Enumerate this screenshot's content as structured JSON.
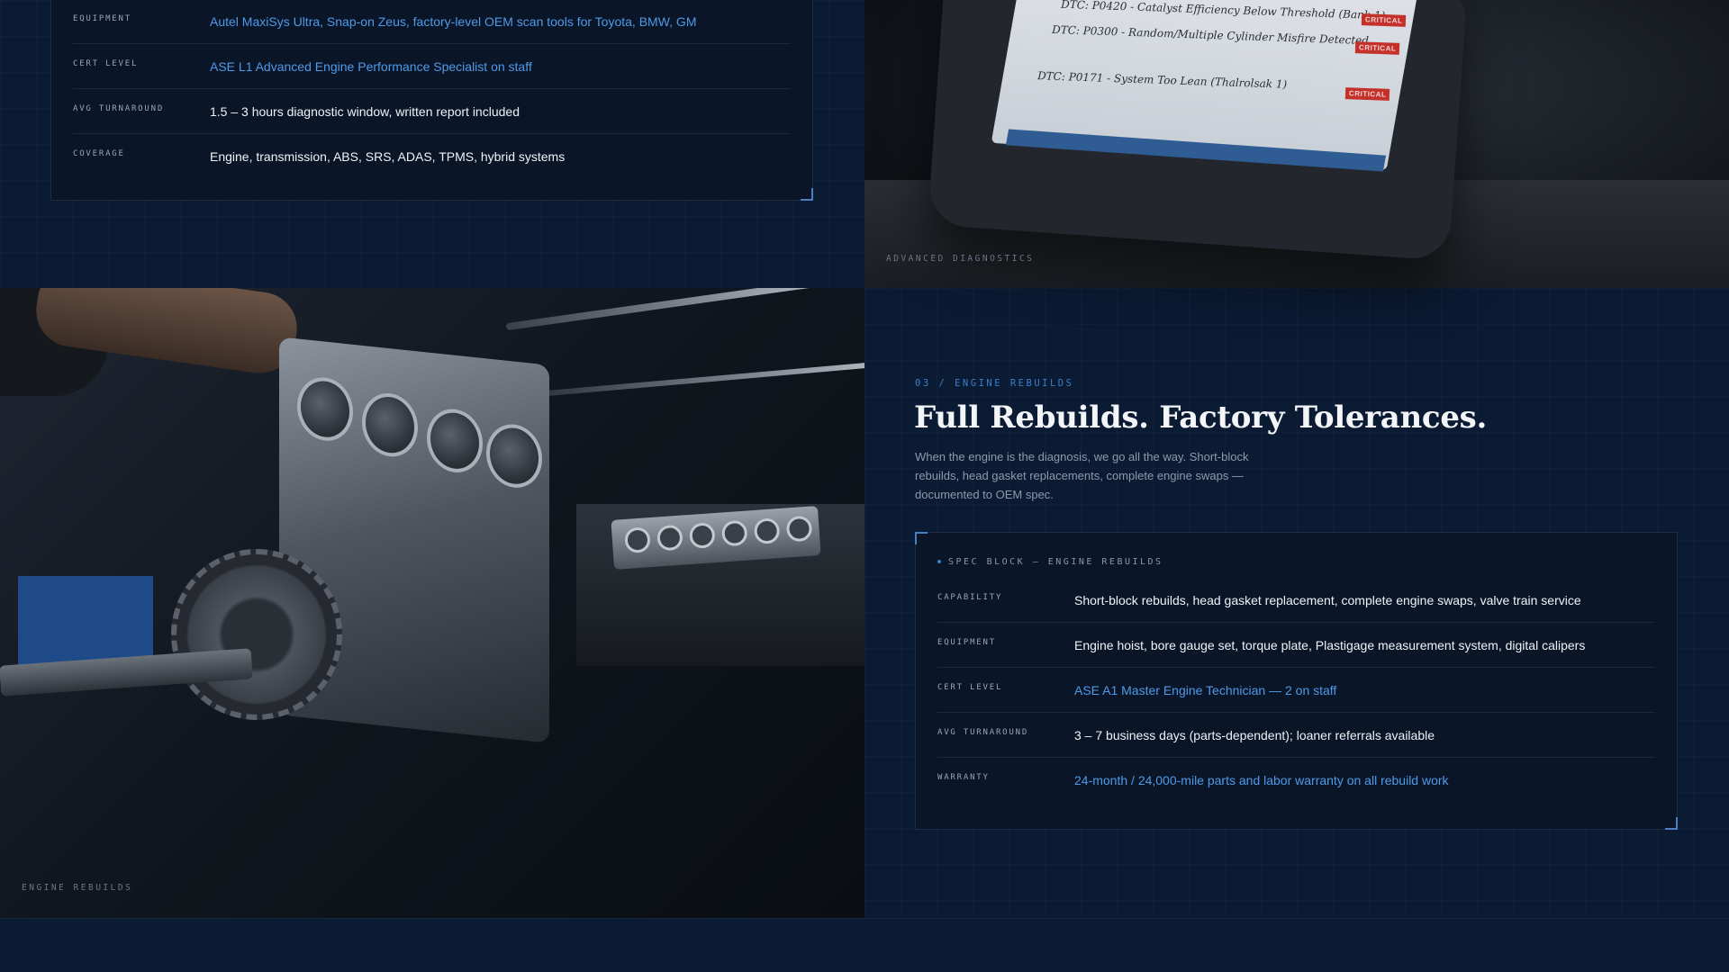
{
  "diagnostics_spec": {
    "rows": [
      {
        "label": "EQUIPMENT",
        "value": "Autel MaxiSys Ultra, Snap-on Zeus, factory-level OEM scan tools for Toyota, BMW, GM"
      },
      {
        "label": "CERT LEVEL",
        "value": "ASE L1 Advanced Engine Performance Specialist on staff"
      },
      {
        "label": "AVG TURNAROUND",
        "value": "1.5 – 3 hours diagnostic window, written report included"
      },
      {
        "label": "COVERAGE",
        "value": "Engine, transmission, ABS, SRS, ADAS, TPMS, hybrid systems"
      }
    ]
  },
  "diagnostics_image": {
    "caption": "ADVANCED DIAGNOSTICS",
    "dtc_lines": [
      {
        "code": "DTC: P0420 - Catalyst Efficiency Below Threshold (Bank 1)",
        "badge": "CRITICAL"
      },
      {
        "code": "DTC: P0300 - Random/Multiple Cylinder Misfire Detected",
        "badge": "CRITICAL"
      },
      {
        "code": "DTC: P0171 - System Too Lean (Thalrolsak 1)",
        "badge": "CRITICAL"
      }
    ]
  },
  "rebuilds_image": {
    "caption": "ENGINE REBUILDS"
  },
  "rebuilds": {
    "eyebrow": "03 / ENGINE REBUILDS",
    "headline": "Full Rebuilds. Factory Tolerances.",
    "description": "When the engine is the diagnosis, we go all the way. Short-block rebuilds, head gasket replacements, complete engine swaps — documented to OEM spec.",
    "spec_title": "SPEC BLOCK — ENGINE REBUILDS",
    "rows": [
      {
        "label": "CAPABILITY",
        "value": "Short-block rebuilds, head gasket replacement, complete engine swaps, valve train service"
      },
      {
        "label": "EQUIPMENT",
        "value": "Engine hoist, bore gauge set, torque plate, Plastigage measurement system, digital calipers"
      },
      {
        "label": "CERT LEVEL",
        "value": "ASE A1 Master Engine Technician — 2 on staff"
      },
      {
        "label": "AVG TURNAROUND",
        "value": "3 – 7 business days (parts-dependent); loaner referrals available"
      },
      {
        "label": "WARRANTY",
        "value": "24-month / 24,000-mile parts and labor warranty on all rebuild work"
      }
    ]
  },
  "colors": {
    "background": "#0b1b33",
    "card": "#0a1628",
    "accent": "#4f9ae8",
    "critical": "#c4312b"
  }
}
